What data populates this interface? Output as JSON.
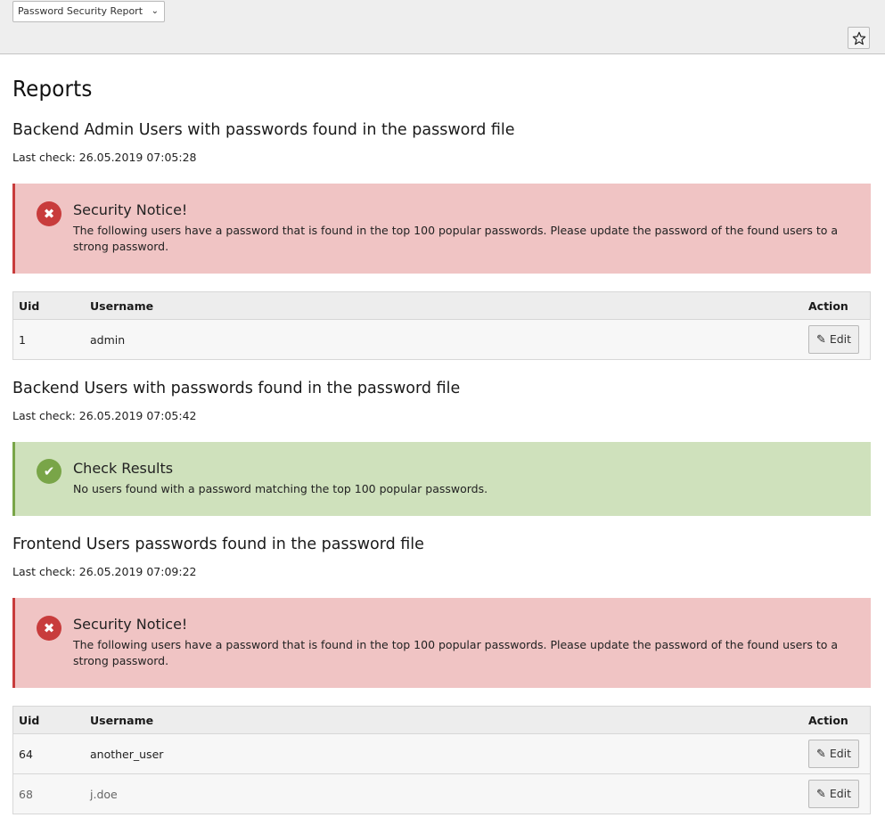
{
  "toolbar": {
    "report_select": "Password Security Report",
    "bookmark_icon": "star-icon"
  },
  "page": {
    "title": "Reports"
  },
  "sections": [
    {
      "title": "Backend Admin Users with passwords found in the password file",
      "last_check": "Last check: 26.05.2019 07:05:28",
      "callout": {
        "type": "danger",
        "icon": "error-x-icon",
        "title": "Security Notice!",
        "text": "The following users have a password that is found in the top 100 popular passwords. Please update the password of the found users to a strong password."
      },
      "table": {
        "headers": [
          "Uid",
          "Username",
          "Action"
        ],
        "rows": [
          {
            "uid": "1",
            "username": "admin",
            "action": "Edit"
          }
        ]
      }
    },
    {
      "title": "Backend Users with passwords found in the password file",
      "last_check": "Last check: 26.05.2019 07:05:42",
      "callout": {
        "type": "success",
        "icon": "check-icon",
        "title": "Check Results",
        "text": "No users found with a password matching the top 100 popular passwords."
      }
    },
    {
      "title": "Frontend Users passwords found in the password file",
      "last_check": "Last check: 26.05.2019 07:09:22",
      "callout": {
        "type": "danger",
        "icon": "error-x-icon",
        "title": "Security Notice!",
        "text": "The following users have a password that is found in the top 100 popular passwords. Please update the password of the found users to a strong password."
      },
      "table": {
        "headers": [
          "Uid",
          "Username",
          "Action"
        ],
        "rows": [
          {
            "uid": "64",
            "username": "another_user",
            "action": "Edit"
          },
          {
            "uid": "68",
            "username": "j.doe",
            "action": "Edit"
          }
        ]
      }
    }
  ],
  "colors": {
    "danger_bg": "#f0c4c4",
    "danger_accent": "#c83c3c",
    "success_bg": "#cfe1bc",
    "success_accent": "#79a548"
  }
}
